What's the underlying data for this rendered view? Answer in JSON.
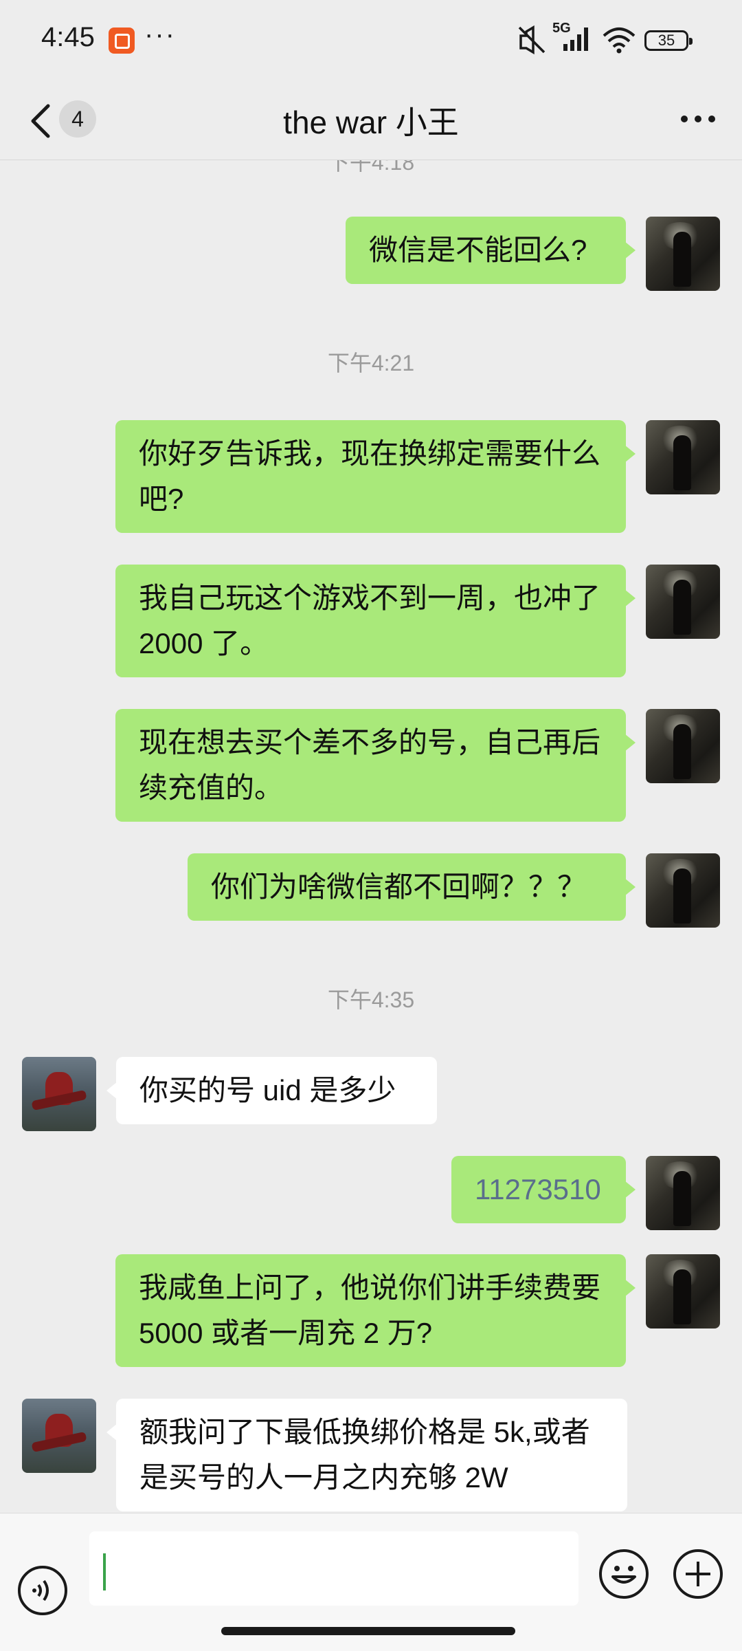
{
  "status_bar": {
    "time": "4:45",
    "app_icon": "app-notification-icon",
    "dots": "···",
    "network": "5G",
    "battery": "35"
  },
  "nav": {
    "unread_count": "4",
    "title": "the war 小王",
    "back_icon": "chevron-left-icon",
    "more_icon": "more-icon"
  },
  "chat": {
    "partial_timestamp": "下午4:18",
    "timestamps": [
      "下午4:21",
      "下午4:35"
    ],
    "messages": [
      {
        "from": "me",
        "text": "微信是不能回么?"
      },
      {
        "from": "me",
        "text": "你好歹告诉我，现在换绑定需要什么吧?"
      },
      {
        "from": "me",
        "text": "我自己玩这个游戏不到一周，也冲了 2000 了。"
      },
      {
        "from": "me",
        "text": "现在想去买个差不多的号，自己再后续充值的。"
      },
      {
        "from": "me",
        "text": "你们为啥微信都不回啊？？？"
      },
      {
        "from": "them",
        "text": "你买的号 uid 是多少"
      },
      {
        "from": "me",
        "text": "11273510"
      },
      {
        "from": "me",
        "text": "我咸鱼上问了，他说你们讲手续费要 5000 或者一周充 2 万?"
      },
      {
        "from": "them",
        "text": "额我问了下最低换绑价格是 5k,或者是买号的人一月之内充够 2W"
      }
    ]
  },
  "input_bar": {
    "voice_icon": "voice-icon",
    "emoji_icon": "emoji-icon",
    "plus_icon": "plus-icon",
    "value": ""
  },
  "colors": {
    "background": "#ededed",
    "my_bubble": "#a9e97a",
    "their_bubble": "#ffffff"
  }
}
